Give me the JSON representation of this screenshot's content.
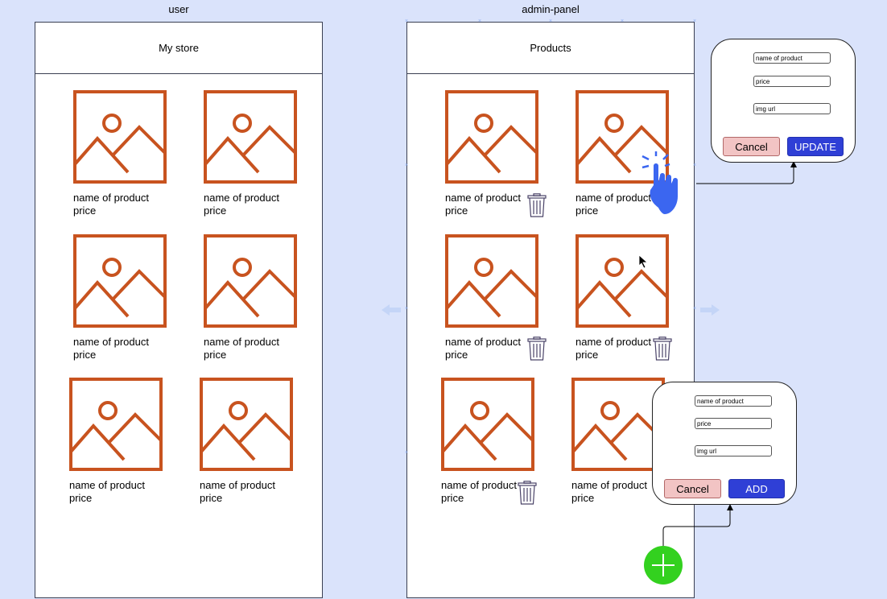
{
  "labels": {
    "user_frame": "user",
    "admin_frame": "admin-panel"
  },
  "user": {
    "title": "My store",
    "products": [
      {
        "name": "name of product",
        "price": "price"
      },
      {
        "name": "name of product",
        "price": "price"
      },
      {
        "name": "name of product",
        "price": "price"
      },
      {
        "name": "name of product",
        "price": "price"
      },
      {
        "name": "name of product",
        "price": "price"
      },
      {
        "name": "name of product",
        "price": "price"
      }
    ]
  },
  "admin": {
    "title": "Products",
    "products": [
      {
        "name": "name of product",
        "price": "price"
      },
      {
        "name": "name of product",
        "price": "price"
      },
      {
        "name": "name of product",
        "price": "price"
      },
      {
        "name": "name of product",
        "price": "price"
      },
      {
        "name": "name of product",
        "price": "price"
      },
      {
        "name": "name of product",
        "price": "price"
      }
    ]
  },
  "update_popup": {
    "name_placeholder": "name of product",
    "price_placeholder": "price",
    "img_placeholder": "img url",
    "cancel_label": "Cancel",
    "submit_label": "UPDATE"
  },
  "add_popup": {
    "name_placeholder": "name of product",
    "price_placeholder": "price",
    "img_placeholder": "img url",
    "cancel_label": "Cancel",
    "submit_label": "ADD"
  },
  "colors": {
    "background": "#dae3fb",
    "image_icon": "#c8531f",
    "primary_button": "#2f3fd6",
    "cancel_button": "#f2c4c4",
    "fab": "#33d11f",
    "hand": "#3b66f0"
  },
  "icons": [
    "image-placeholder-icon",
    "trash-icon",
    "hand-pointer-icon",
    "plus-icon",
    "mouse-cursor-icon"
  ]
}
